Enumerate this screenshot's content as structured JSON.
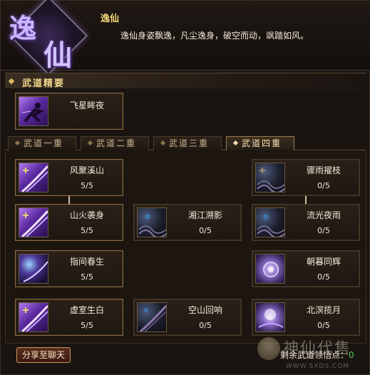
{
  "header": {
    "emblem_chars": [
      "逸",
      "仙"
    ],
    "title": "逸仙",
    "description": "逸仙身姿飘逸，凡尘逸身，破空而动，飒踏如风。"
  },
  "section": {
    "title": "武道精要"
  },
  "featured_skill": {
    "name": "飞星眸夜",
    "icon": "flying-figure-icon"
  },
  "tabs": [
    {
      "label": "武道一重",
      "active": false
    },
    {
      "label": "武道二重",
      "active": false
    },
    {
      "label": "武道三重",
      "active": false
    },
    {
      "label": "武道四重",
      "active": true
    }
  ],
  "skills": {
    "fengjuxishan": {
      "name": "风聚溪山",
      "level": "5/5",
      "icon": "purple-slash-icon"
    },
    "shanhuoxishen": {
      "name": "山火袭身",
      "level": "5/5",
      "icon": "purple-slash-icon"
    },
    "zhijianchunsheng": {
      "name": "指间春生",
      "level": "5/5",
      "icon": "purple-moon-icon"
    },
    "xushishengbai": {
      "name": "虚室生白",
      "level": "5/5",
      "icon": "purple-slash-icon"
    },
    "xiangjiangsuying": {
      "name": "湘江溯影",
      "level": "0/5",
      "icon": "dark-storm-icon"
    },
    "kongshanhuixiang": {
      "name": "空山回响",
      "level": "0/5",
      "icon": "dark-slash-icon"
    },
    "zhouyuzhuozhi": {
      "name": "骤雨擢枝",
      "level": "0/5",
      "icon": "dark-storm-icon"
    },
    "liuguangyeyu": {
      "name": "流光夜雨",
      "level": "0/5",
      "icon": "dark-storm-icon"
    },
    "zhaomutonghui": {
      "name": "朝暮同辉",
      "level": "0/5",
      "icon": "lavender-swirl-icon"
    },
    "beimingjiaoyue": {
      "name": "北溟揽月",
      "level": "0/5",
      "icon": "dark-moon-icon"
    }
  },
  "footer": {
    "share_label": "分享至聊天",
    "remaining_label": "剩余武道领悟点：",
    "remaining_value": "0"
  },
  "watermark": {
    "text": "神仙代售",
    "url": "WWW.SXDS.COM"
  },
  "colors": {
    "gold_title": "#f5d97a",
    "border_gold": "#8a6a3e",
    "remaining_green": "#4bd05a"
  }
}
